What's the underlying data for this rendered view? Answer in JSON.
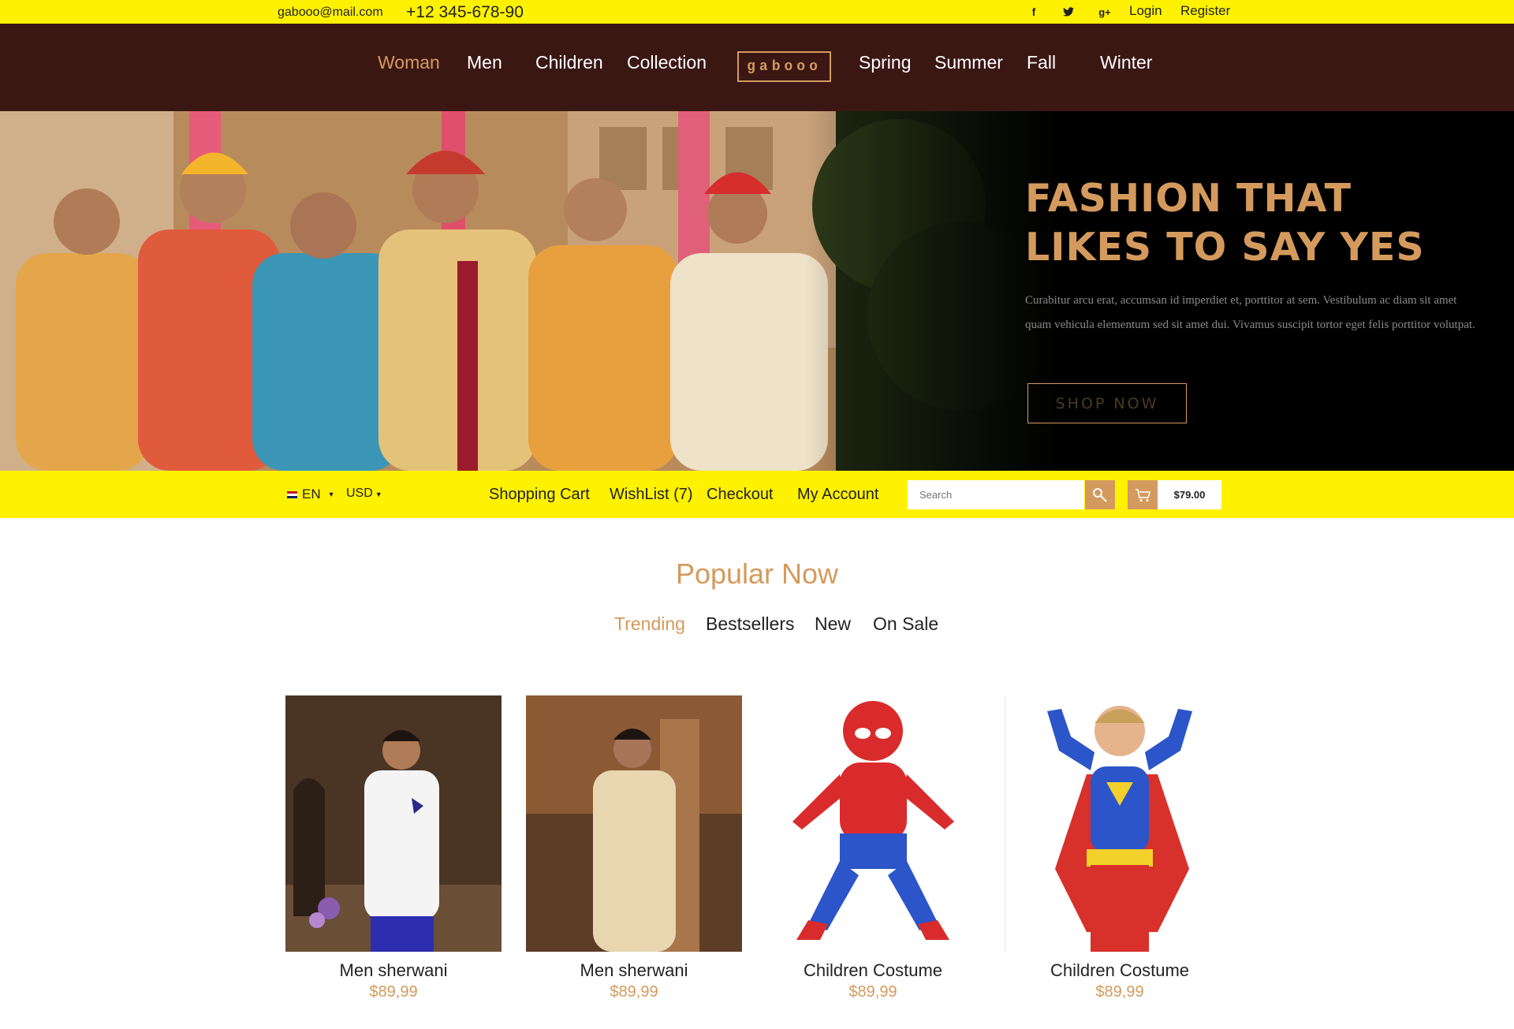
{
  "topbar": {
    "email": "gabooo@mail.com",
    "phone": "+12 345-678-90",
    "social": [
      {
        "icon": "facebook-icon",
        "glyph": "f"
      },
      {
        "icon": "twitter-icon",
        "glyph": "t"
      },
      {
        "icon": "google-plus-icon",
        "glyph": "g+"
      }
    ],
    "login_label": "Login",
    "register_label": "Register"
  },
  "nav": {
    "items": [
      {
        "label": "Woman",
        "active": true
      },
      {
        "label": "Men"
      },
      {
        "label": "Children"
      },
      {
        "label": "Collection"
      },
      {
        "label": "Spring"
      },
      {
        "label": "Summer"
      },
      {
        "label": "Fall"
      },
      {
        "label": "Winter"
      }
    ],
    "logo_text": "gabooo"
  },
  "hero": {
    "title": "FASHION THAT LIKES TO SAY YES",
    "text": "Curabitur arcu erat, accumsan id imperdiet et, porttitor at sem. Vestibulum ac diam sit amet quam vehicula elementum sed sit amet dui. Vivamus suscipit tortor eget felis porttitor volutpat.",
    "button_label": "SHOP NOW"
  },
  "utility": {
    "language": "EN",
    "currency": "USD",
    "links": [
      "Shopping Cart",
      "WishList (7)",
      "Checkout",
      "My Account"
    ],
    "search_placeholder": "Search",
    "cart_total": "$79.00"
  },
  "popular": {
    "title": "Popular Now",
    "tabs": [
      {
        "label": "Trending",
        "active": true
      },
      {
        "label": "Bestsellers"
      },
      {
        "label": "New"
      },
      {
        "label": "On Sale"
      }
    ],
    "products": [
      {
        "name": "Men sherwani",
        "price": "$89,99"
      },
      {
        "name": "Men sherwani",
        "price": "$89,99"
      },
      {
        "name": "Children Costume",
        "price": "$89,99"
      },
      {
        "name": "Children Costume",
        "price": "$89,99"
      }
    ]
  },
  "colors": {
    "accent": "#d49a5d",
    "topbar_bg": "#fff200",
    "nav_bg": "#3b1714"
  }
}
